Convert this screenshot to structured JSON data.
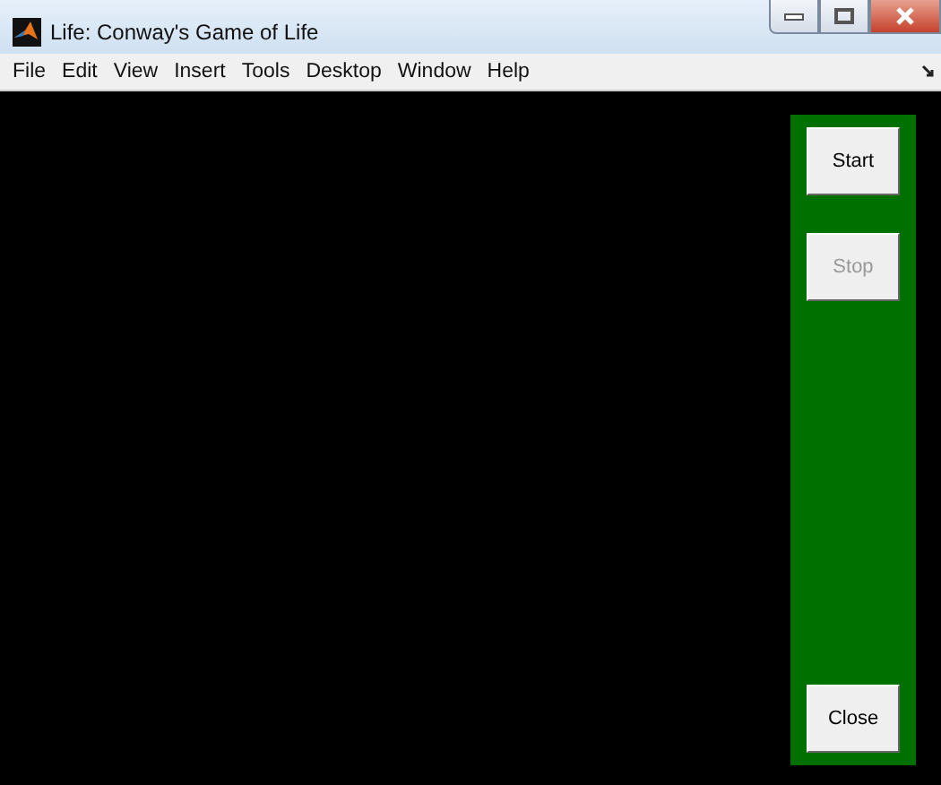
{
  "window": {
    "title": "Life: Conway's Game of Life"
  },
  "menu": [
    "File",
    "Edit",
    "View",
    "Insert",
    "Tools",
    "Desktop",
    "Window",
    "Help"
  ],
  "buttons": [
    {
      "label": "Start",
      "disabled": false,
      "kind": "top"
    },
    {
      "label": "Stop",
      "disabled": true,
      "kind": "top"
    },
    {
      "label": "Close",
      "disabled": false,
      "kind": "bottom"
    }
  ]
}
